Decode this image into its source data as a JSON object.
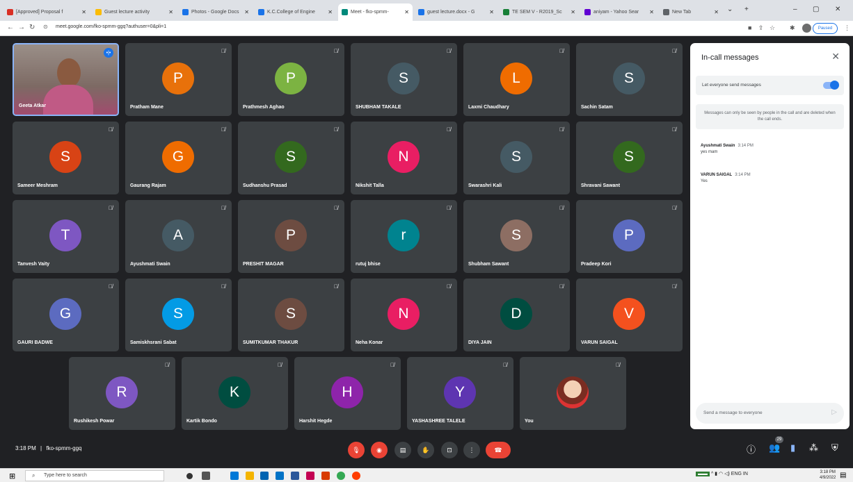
{
  "browser": {
    "tabs": [
      {
        "label": "[Approved] Proposal f",
        "color": "#d93025",
        "active": false
      },
      {
        "label": "Guest lecture activity",
        "color": "#fbbc04",
        "active": false
      },
      {
        "label": "Photos - Google Docs",
        "color": "#1a73e8",
        "active": false
      },
      {
        "label": "K.C.College of Engine",
        "color": "#1a73e8",
        "active": false
      },
      {
        "label": "Meet - fko-spmm-",
        "color": "#00897b",
        "active": true
      },
      {
        "label": "guest lecture.docx - G",
        "color": "#1a73e8",
        "active": false
      },
      {
        "label": "TE SEM V - R2019_Sc",
        "color": "#188038",
        "active": false
      },
      {
        "label": "aniyam - Yahoo Sear",
        "color": "#6001d2",
        "active": false
      },
      {
        "label": "New Tab",
        "color": "#5f6368",
        "active": false
      }
    ],
    "url": "meet.google.com/fko-spmm-ggq?authuser=0&pli=1",
    "paused_label": "Paused"
  },
  "tiles": [
    {
      "name": "Geeta Atkar",
      "video": true
    },
    {
      "name": "Pratham Mane",
      "initial": "P",
      "color": "#e8710a"
    },
    {
      "name": "Prathmesh Aghao",
      "initial": "P",
      "color": "#7cb342"
    },
    {
      "name": "SHUBHAM TAKALE",
      "initial": "S",
      "color": "#455a64"
    },
    {
      "name": "Laxmi Chaudhary",
      "initial": "L",
      "color": "#ef6c00"
    },
    {
      "name": "Sachin Satam",
      "initial": "S",
      "color": "#455a64"
    },
    {
      "name": "Sameer Meshram",
      "initial": "S",
      "color": "#d84315"
    },
    {
      "name": "Gaurang Rajam",
      "initial": "G",
      "color": "#ef6c00"
    },
    {
      "name": "Sudhanshu Prasad",
      "initial": "S",
      "color": "#33691e"
    },
    {
      "name": "Nikshit Talla",
      "initial": "N",
      "color": "#e91e63"
    },
    {
      "name": "Swarashri Kali",
      "initial": "S",
      "color": "#455a64"
    },
    {
      "name": "Shravani Sawant",
      "initial": "S",
      "color": "#33691e"
    },
    {
      "name": "Tanvesh Vaity",
      "initial": "T",
      "color": "#7e57c2"
    },
    {
      "name": "Ayushmati Swain",
      "initial": "A",
      "color": "#455a64"
    },
    {
      "name": "PRESHIT MAGAR",
      "initial": "P",
      "color": "#6d4c41"
    },
    {
      "name": "rutuj bhise",
      "initial": "r",
      "color": "#00838f"
    },
    {
      "name": "Shubham Sawant",
      "initial": "S",
      "color": "#8d6e63"
    },
    {
      "name": "Pradeep Kori",
      "initial": "P",
      "color": "#5c6bc0"
    },
    {
      "name": "GAURI BADWE",
      "initial": "G",
      "color": "#5c6bc0"
    },
    {
      "name": "Samiskhsrani Sabat",
      "initial": "S",
      "color": "#039be5"
    },
    {
      "name": "SUMITKUMAR THAKUR",
      "initial": "S",
      "color": "#6d4c41"
    },
    {
      "name": "Neha Konar",
      "initial": "N",
      "color": "#e91e63"
    },
    {
      "name": "DIYA JAIN",
      "initial": "D",
      "color": "#004d40"
    },
    {
      "name": "VARUN SAIGAL",
      "initial": "V",
      "color": "#f4511e"
    },
    {
      "name": "Rushikesh Powar",
      "initial": "R",
      "color": "#7e57c2"
    },
    {
      "name": "Kartik Bondo",
      "initial": "K",
      "color": "#004d40"
    },
    {
      "name": "Harshit Hegde",
      "initial": "H",
      "color": "#8e24aa"
    },
    {
      "name": "YASHASHREE TALELE",
      "initial": "Y",
      "color": "#5e35b1"
    },
    {
      "name": "You",
      "photo": true
    }
  ],
  "chat": {
    "title": "In-call messages",
    "toggle_label": "Let everyone send messages",
    "notice": "Messages can only be seen by people in the call and are deleted when the call ends.",
    "messages": [
      {
        "sender": "Ayushmati Swain",
        "time": "3:14 PM",
        "text": "yes mam"
      },
      {
        "sender": "VARUN SAIGAL",
        "time": "3:14 PM",
        "text": "Yes"
      }
    ],
    "input_placeholder": "Send a message to everyone"
  },
  "bottom": {
    "time": "3:18 PM",
    "separator": "|",
    "meeting_code": "fko-spmm-ggq",
    "participants_count": "29"
  },
  "taskbar": {
    "search_placeholder": "Type here to search",
    "tray_lang": "ENG",
    "tray_region": "IN",
    "clock_time": "3:18 PM",
    "clock_date": "4/9/2022"
  }
}
